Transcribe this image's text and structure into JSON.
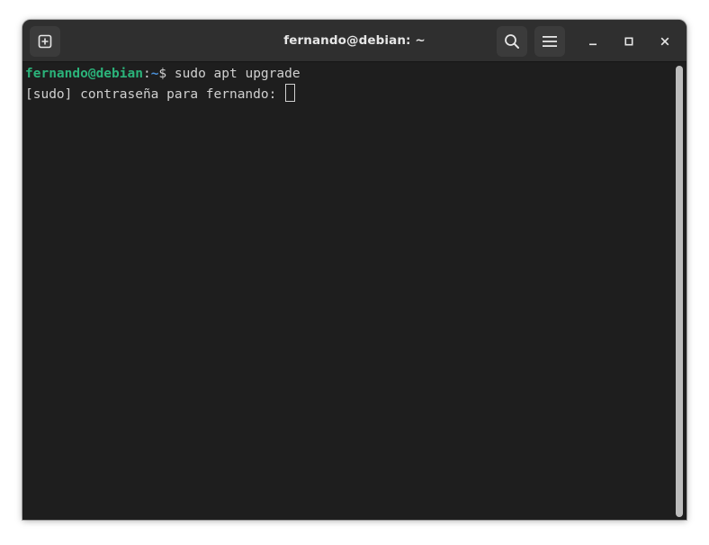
{
  "window": {
    "title": "fernando@debian: ~"
  },
  "headerbar": {
    "new_tab_icon": "new-tab-icon",
    "search_icon": "search-icon",
    "menu_icon": "hamburger-menu-icon",
    "minimize_icon": "minimize-icon",
    "maximize_icon": "maximize-icon",
    "close_icon": "close-icon"
  },
  "terminal": {
    "prompt": {
      "user_host": "fernando@debian",
      "colon": ":",
      "path": "~",
      "symbol": "$ ",
      "command": "sudo apt upgrade"
    },
    "password_prompt": "[sudo] contraseña para fernando: "
  },
  "colors": {
    "background": "#1e1e1e",
    "headerbar": "#2f2f2f",
    "prompt_user": "#2bb37a",
    "prompt_path": "#4a90d9",
    "text": "#d0d0d0"
  }
}
